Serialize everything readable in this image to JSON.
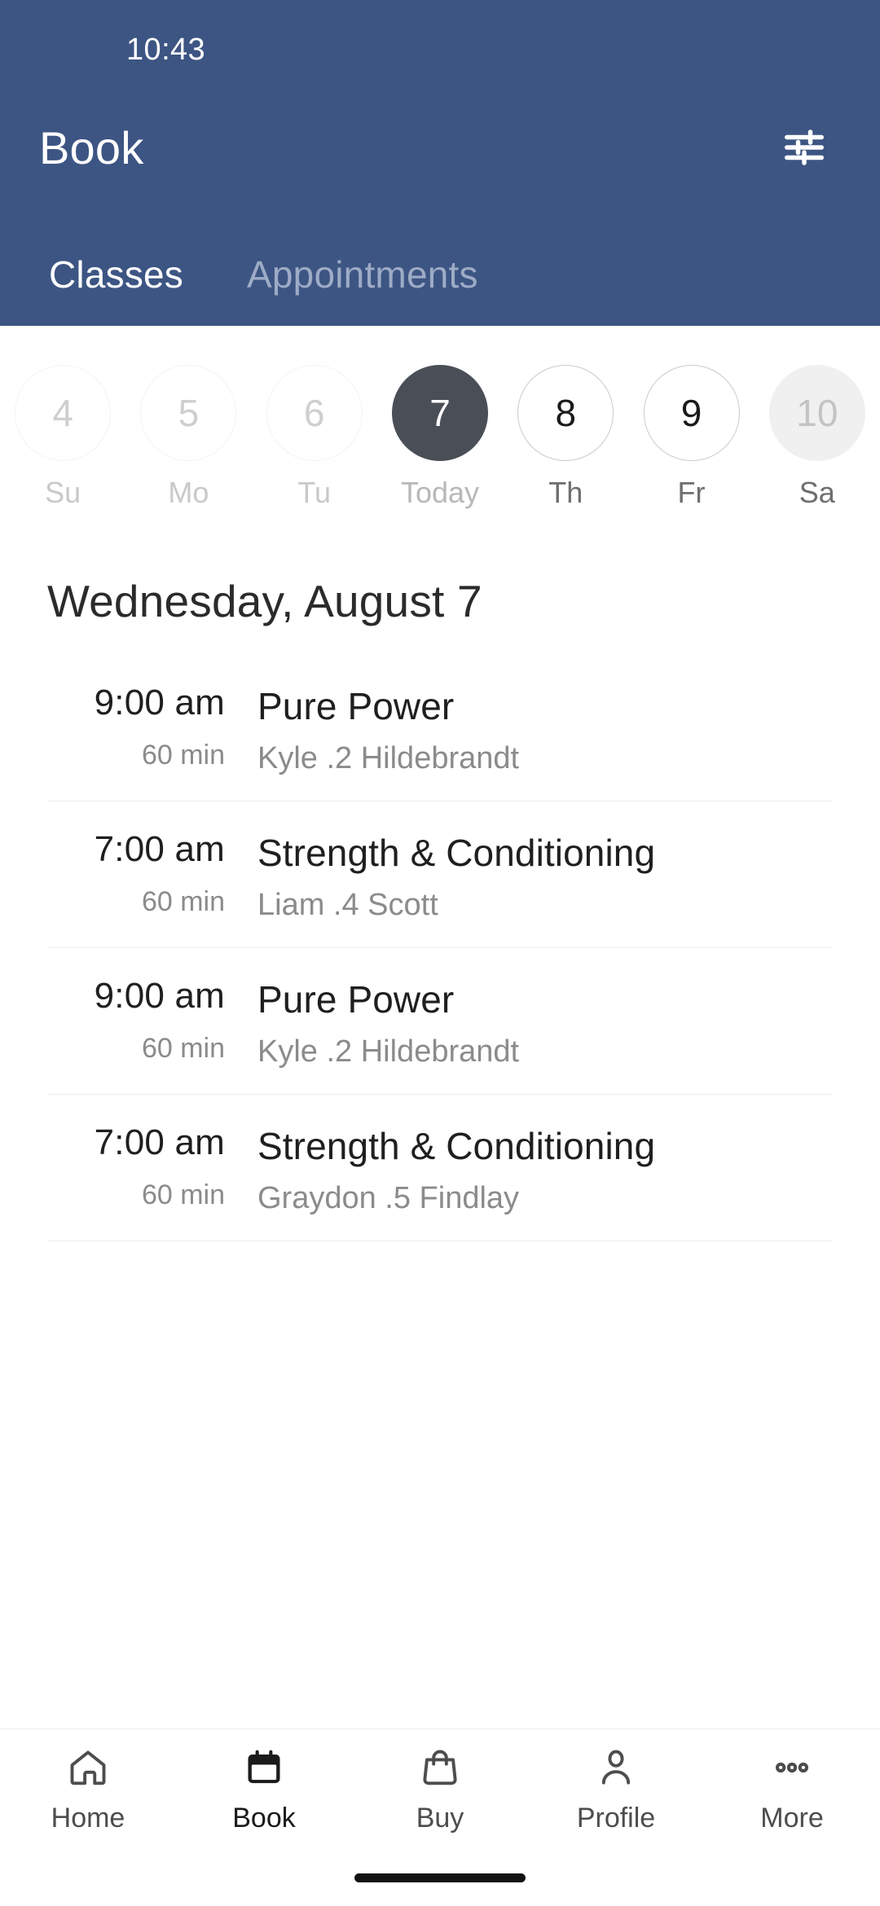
{
  "status_bar": {
    "time": "10:43"
  },
  "header": {
    "title": "Book",
    "filter_icon": "tune-icon",
    "tabs": [
      {
        "label": "Classes",
        "active": true
      },
      {
        "label": "Appointments",
        "active": false
      }
    ]
  },
  "date_strip": [
    {
      "day": "4",
      "label": "Su",
      "state": "disabled"
    },
    {
      "day": "5",
      "label": "Mo",
      "state": "disabled"
    },
    {
      "day": "6",
      "label": "Tu",
      "state": "disabled"
    },
    {
      "day": "7",
      "label": "Today",
      "state": "selected"
    },
    {
      "day": "8",
      "label": "Th",
      "state": "available"
    },
    {
      "day": "9",
      "label": "Fr",
      "state": "available"
    },
    {
      "day": "10",
      "label": "Sa",
      "state": "softfill"
    }
  ],
  "main": {
    "date_heading": "Wednesday, August 7",
    "classes": [
      {
        "time": "9:00 am",
        "duration": "60 min",
        "title": "Pure Power",
        "instructor": "Kyle .2 Hildebrandt"
      },
      {
        "time": "7:00 am",
        "duration": "60 min",
        "title": "Strength & Conditioning",
        "instructor": "Liam .4 Scott"
      },
      {
        "time": "9:00 am",
        "duration": "60 min",
        "title": "Pure Power",
        "instructor": "Kyle .2 Hildebrandt"
      },
      {
        "time": "7:00 am",
        "duration": "60 min",
        "title": "Strength & Conditioning",
        "instructor": "Graydon .5 Findlay"
      }
    ]
  },
  "bottom_nav": [
    {
      "label": "Home",
      "icon": "home-icon",
      "active": false
    },
    {
      "label": "Book",
      "icon": "calendar-icon",
      "active": true
    },
    {
      "label": "Buy",
      "icon": "bag-icon",
      "active": false
    },
    {
      "label": "Profile",
      "icon": "person-icon",
      "active": false
    },
    {
      "label": "More",
      "icon": "dots-icon",
      "active": false
    }
  ],
  "colors": {
    "header_blue": "#3d5583",
    "tab_inactive": "#9eabc6",
    "selected_day": "#4a4e57",
    "soft_fill": "#f0f0f0",
    "divider": "#ececec",
    "text_primary": "#1f1f1f",
    "text_muted": "#8b8b8b"
  }
}
